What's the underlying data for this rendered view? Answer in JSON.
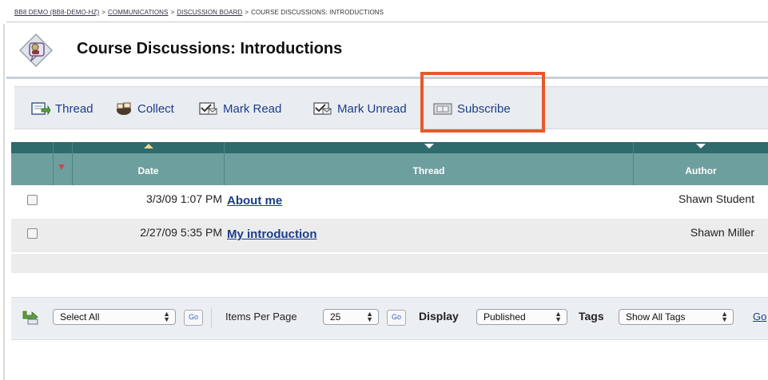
{
  "breadcrumb": {
    "items": [
      "BB8 DEMO (BB8-DEMO-HZ)",
      "COMMUNICATIONS",
      "DISCUSSION BOARD",
      "COURSE DISCUSSIONS: INTRODUCTIONS"
    ],
    "separator": ">"
  },
  "page": {
    "title": "Course Discussions: Introductions"
  },
  "toolbar": {
    "thread": "Thread",
    "collect": "Collect",
    "mark_read": "Mark Read",
    "mark_unread": "Mark Unread",
    "subscribe": "Subscribe"
  },
  "highlight": {
    "color": "#e65a2a"
  },
  "table": {
    "columns": {
      "date": "Date",
      "thread": "Thread",
      "author": "Author"
    },
    "rows": [
      {
        "date": "3/3/09 1:07 PM",
        "thread": "About me",
        "author": "Shawn Student"
      },
      {
        "date": "2/27/09 5:35 PM",
        "thread": "My introduction",
        "author": "Shawn Miller"
      }
    ]
  },
  "bottom": {
    "select_all": "Select All",
    "go": "Go",
    "items_per_page_label": "Items Per Page",
    "items_per_page_value": "25",
    "display_label": "Display",
    "display_value": "Published",
    "tags_label": "Tags",
    "tags_value": "Show All Tags",
    "go_link": "Go"
  },
  "colors": {
    "header": "#6d9f9e",
    "header_dark": "#2f6a6c",
    "link": "#1a3d8a"
  }
}
